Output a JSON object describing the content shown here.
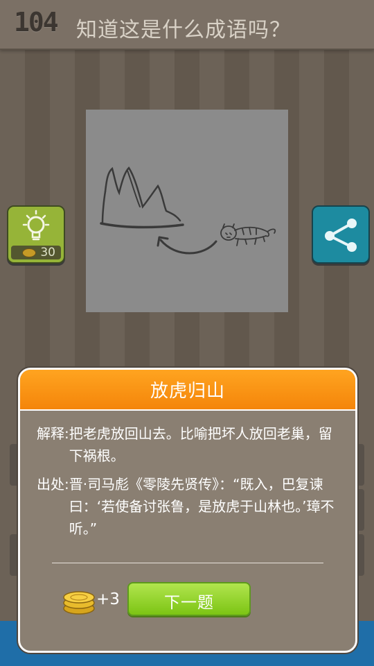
{
  "header": {
    "level": "104",
    "question": "知道这是什么成语吗？"
  },
  "hint": {
    "icon": "lightbulb-icon",
    "cost": "30",
    "color": "#96b438"
  },
  "share": {
    "icon": "share-icon",
    "color": "#1d8ba0"
  },
  "dialog": {
    "title": "放虎归山",
    "explain_label": "解释:",
    "explain_text": "把老虎放回山去。比喻把坏人放回老巢，留下祸根。",
    "source_label": "出处:",
    "source_text": "晋·司马彪《零陵先贤传》：“既入，巴复谏曰：‘若使备讨张鲁，是放虎于山林也。’璋不听。”",
    "reward": "+3",
    "next_label": "下一题",
    "header_color": "#f99a14",
    "button_color": "#8fd12c"
  }
}
